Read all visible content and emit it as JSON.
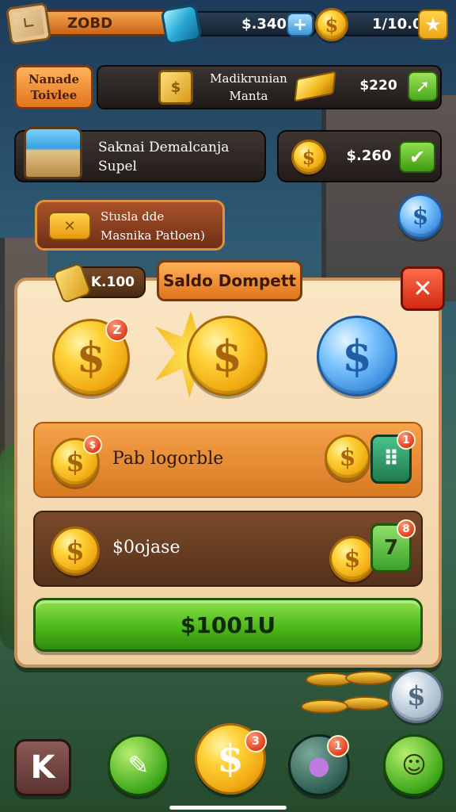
{
  "topbar": {
    "left_value": "ZOBD",
    "mid_value": "$.340",
    "plus_label": "+",
    "coin_symbol": "$",
    "right_value": "1/10.0",
    "star_glyph": "★"
  },
  "row2": {
    "tag_line1": "Nanade",
    "tag_line2": "Toivlee",
    "crate_symbol": "$",
    "title_line1": "Madikrunian",
    "title_line2": "Manta",
    "value": "$220",
    "arrow_glyph": "➚"
  },
  "chest": {
    "title_line1": "Saknai Demalcanja",
    "title_line2": "Supel"
  },
  "price": {
    "coin_symbol": "$",
    "value": "$.260",
    "check_glyph": "✔"
  },
  "status": {
    "icon_glyph": "✕",
    "line1": "Stusla dde",
    "line2": "Masnika Patloen)"
  },
  "side_coin_symbol": "$",
  "panel": {
    "amount": "K.100",
    "title": "Saldo Dompett",
    "close_glyph": "✕",
    "coins": [
      {
        "symbol": "$",
        "badge": "Z"
      },
      {
        "symbol": "$"
      },
      {
        "symbol": "$"
      }
    ],
    "items": [
      {
        "coin_symbol": "$",
        "coin_badge": "$",
        "label": "Pab logorble",
        "right_coin_symbol": "$",
        "tile_glyph": "⠿",
        "tile_badge": "1"
      },
      {
        "coin_symbol": "$",
        "label": "$0ojase",
        "right_coin_symbol": "$",
        "tile_glyph": "7",
        "tile_badge": "8"
      }
    ],
    "buy_label": "$1001U"
  },
  "floating_coin_symbol": "$",
  "nav": {
    "back_glyph": "K",
    "book_glyph": "✎",
    "coin_symbol": "$",
    "coin_badge": "3",
    "pet_glyph": "●",
    "pet_badge": "1",
    "face_glyph": "☺"
  },
  "colors": {
    "accent_orange": "#e0741c",
    "button_green": "#4eb81a",
    "close_red": "#d02a10",
    "panel_cream": "#fbe6c4",
    "coin_gold": "#ffd23a",
    "coin_blue": "#3b8de0"
  }
}
